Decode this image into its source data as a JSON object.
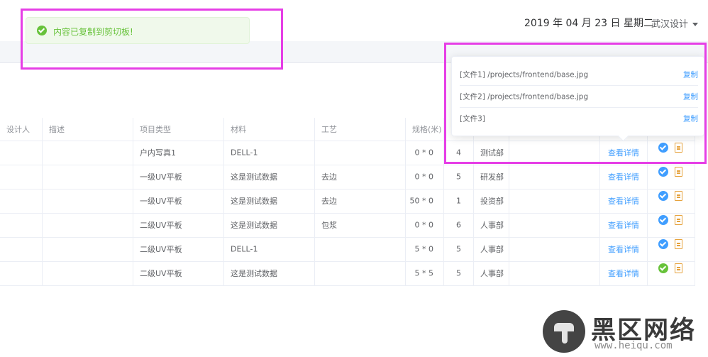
{
  "header": {
    "date": "2019 年 04 月 23 日 星期二",
    "user": "武汉设计"
  },
  "toast": {
    "message": "内容已复制到剪切板!"
  },
  "table": {
    "columns": [
      "设计人",
      "描述",
      "项目类型",
      "材料",
      "工艺",
      "规格(米)"
    ],
    "rows": [
      {
        "type": "户内写真1",
        "material": "DELL-1",
        "process": "",
        "spec": "0 * 0",
        "qty": "4",
        "dept": "测试部",
        "action": "查看详情",
        "status": "blue"
      },
      {
        "type": "一级UV平板",
        "material": "这是测试数据",
        "process": "去边",
        "spec": "0 * 0",
        "qty": "5",
        "dept": "研发部",
        "action": "查看详情",
        "status": "blue"
      },
      {
        "type": "一级UV平板",
        "material": "这是测试数据",
        "process": "去边",
        "spec": "50 * 0",
        "qty": "1",
        "dept": "投资部",
        "action": "查看详情",
        "status": "blue"
      },
      {
        "type": "二级UV平板",
        "material": "这是测试数据",
        "process": "包浆",
        "spec": "0 * 0",
        "qty": "6",
        "dept": "人事部",
        "action": "查看详情",
        "status": "blue"
      },
      {
        "type": "二级UV平板",
        "material": "DELL-1",
        "process": "",
        "spec": "5 * 0",
        "qty": "5",
        "dept": "人事部",
        "action": "查看详情",
        "status": "blue"
      },
      {
        "type": "二级UV平板",
        "material": "这是测试数据",
        "process": "",
        "spec": "5 * 5",
        "qty": "5",
        "dept": "人事部",
        "action": "查看详情",
        "status": "green"
      }
    ]
  },
  "popover": {
    "files": [
      {
        "label": "[文件1] /projects/frontend/base.jpg",
        "copy": "复制"
      },
      {
        "label": "[文件2] /projects/frontend/base.jpg",
        "copy": "复制"
      },
      {
        "label": "[文件3]",
        "copy": "复制"
      }
    ]
  },
  "watermark": {
    "title": "黑区网络",
    "url": "www.heiqu.com"
  },
  "colors": {
    "primary": "#409eff",
    "success": "#67c23a",
    "warning": "#e6a23c",
    "highlight": "#e63ee6"
  },
  "icons": [
    "success-check-icon",
    "dropdown-caret-icon",
    "status-check-icon",
    "document-icon",
    "watermark-logo-icon"
  ]
}
